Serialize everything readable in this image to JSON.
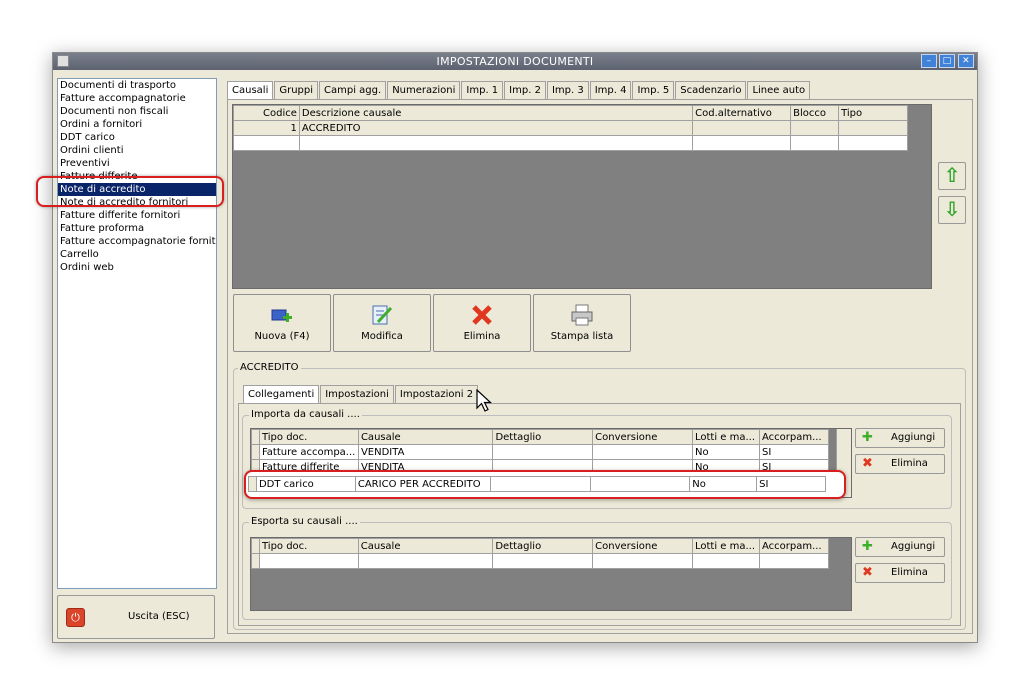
{
  "window": {
    "title": "IMPOSTAZIONI DOCUMENTI"
  },
  "doc_types": [
    "Documenti di trasporto",
    "Fatture accompagnatorie",
    "Documenti non fiscali",
    "Ordini a fornitori",
    "DDT carico",
    "Ordini clienti",
    "Preventivi",
    "Fatture differite",
    "Note di accredito",
    "Note di accredito fornitori",
    "Fatture differite fornitori",
    "Fatture proforma",
    "Fatture accompagnatorie fornito",
    "Carrello",
    "Ordini web"
  ],
  "selected_doc_type": "Note di accredito",
  "exit_label": "Uscita (ESC)",
  "tabs": [
    "Causali",
    "Gruppi",
    "Campi agg.",
    "Numerazioni",
    "Imp. 1",
    "Imp. 2",
    "Imp. 3",
    "Imp. 4",
    "Imp. 5",
    "Scadenzario",
    "Linee auto"
  ],
  "causali_table": {
    "columns": [
      "Codice",
      "Descrizione causale",
      "Cod.alternativo",
      "Blocco",
      "Tipo"
    ],
    "rows": [
      [
        "1",
        "ACCREDITO",
        "",
        "",
        ""
      ]
    ]
  },
  "actions": {
    "new": "Nuova (F4)",
    "edit": "Modifica",
    "delete": "Elimina",
    "print": "Stampa lista"
  },
  "detail": {
    "title": "ACCREDITO",
    "subtabs": [
      "Collegamenti",
      "Impostazioni",
      "Impostazioni 2"
    ],
    "import_group": "Importa da causali ....",
    "export_group": "Esporta su causali ....",
    "columns": [
      "Tipo doc.",
      "Causale",
      "Dettaglio",
      "Conversione",
      "Lotti e ma...",
      "Accorpam..."
    ],
    "import_rows": [
      [
        "Fatture accompa...",
        "VENDITA",
        "",
        "",
        "No",
        "SI"
      ],
      [
        "Fatture differite",
        "VENDITA",
        "",
        "",
        "No",
        "SI"
      ]
    ],
    "highlighted_row": [
      "DDT carico",
      "CARICO PER ACCREDITO",
      "",
      "",
      "No",
      "SI"
    ],
    "add_label": "Aggiungi",
    "remove_label": "Elimina"
  }
}
